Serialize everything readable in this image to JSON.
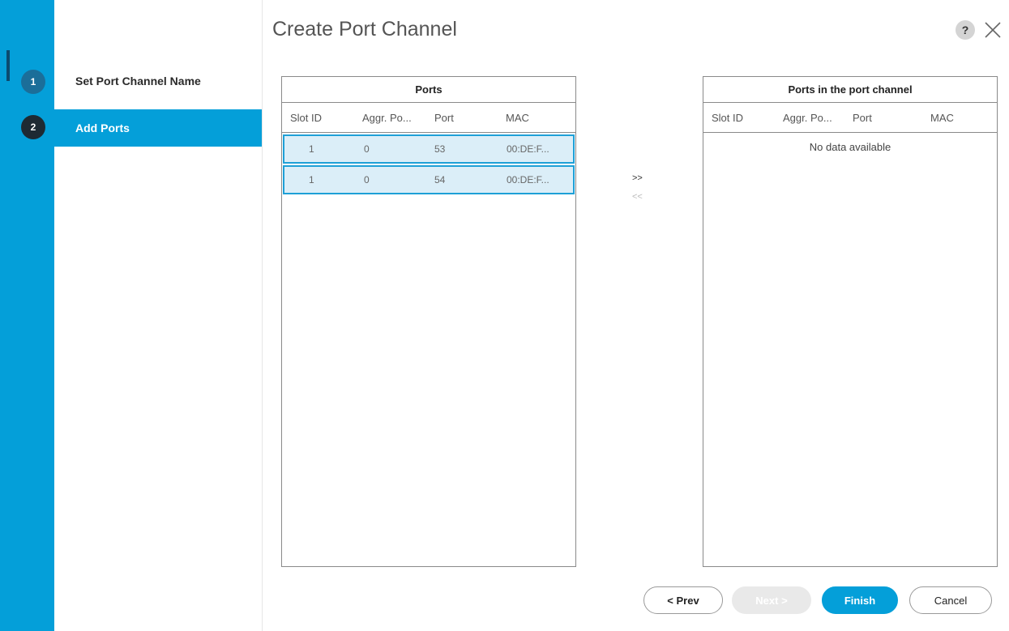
{
  "dialog": {
    "title": "Create Port Channel"
  },
  "wizard": {
    "steps": [
      {
        "number": "1",
        "label": "Set Port Channel Name"
      },
      {
        "number": "2",
        "label": "Add Ports"
      }
    ]
  },
  "ports_table": {
    "title": "Ports",
    "columns": [
      "Slot ID",
      "Aggr. Po...",
      "Port",
      "MAC"
    ],
    "rows": [
      {
        "slot_id": "1",
        "aggr_port": "0",
        "port": "53",
        "mac": "00:DE:F..."
      },
      {
        "slot_id": "1",
        "aggr_port": "0",
        "port": "54",
        "mac": "00:DE:F..."
      }
    ]
  },
  "channel_table": {
    "title": "Ports in the port channel",
    "columns": [
      "Slot ID",
      "Aggr. Po...",
      "Port",
      "MAC"
    ],
    "empty_message": "No data available"
  },
  "move": {
    "add_label": ">>",
    "remove_label": "<<"
  },
  "buttons": {
    "prev": "< Prev",
    "next": "Next >",
    "finish": "Finish",
    "cancel": "Cancel"
  },
  "icons": {
    "help": "?"
  },
  "colors": {
    "accent": "#049fd9",
    "selected_row": "#dbeef8",
    "selected_border": "#1ea0d7"
  }
}
